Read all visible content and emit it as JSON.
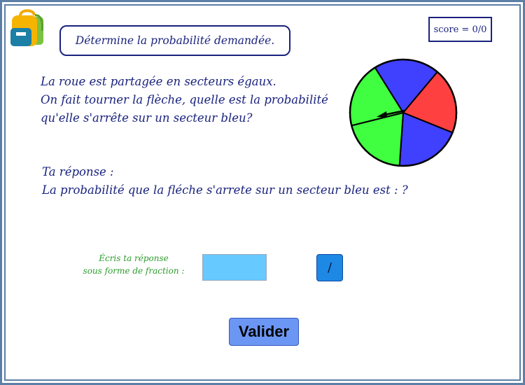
{
  "header": {
    "instruction": "Détermine la probabilité demandée.",
    "score": "score = 0/0"
  },
  "question": {
    "lines": [
      "La roue est partagée en secteurs égaux.",
      "On fait tourner la flèche, quelle est la probabilité",
      "qu'elle s'arrête sur un secteur bleu?"
    ]
  },
  "wheel": {
    "sectors": [
      {
        "color": "#4040ff",
        "name": "bleu"
      },
      {
        "color": "#ff4040",
        "name": "rouge"
      },
      {
        "color": "#4040ff",
        "name": "bleu"
      },
      {
        "color": "#40ff40",
        "name": "vert"
      },
      {
        "color": "#40ff40",
        "name": "vert"
      }
    ]
  },
  "answer": {
    "label": "Ta réponse :",
    "sentence": "La probabilité que la fléche s'arrete sur un secteur bleu est : ?",
    "hint_lines": [
      "Écris ta réponse",
      "sous forme de fraction :"
    ],
    "input_value": "",
    "slash_label": "/"
  },
  "actions": {
    "validate_label": "Valider"
  },
  "colors": {
    "text_primary": "#1a237e",
    "hint_green": "#2e9b2e",
    "input_bg": "#66c9ff",
    "slash_button": "#1e88e5",
    "validate_button": "#6b96f3",
    "frame": "#5b7fa6"
  }
}
